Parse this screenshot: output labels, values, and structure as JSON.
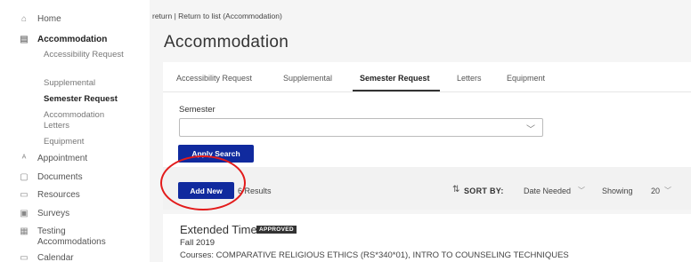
{
  "sidebar": {
    "items": [
      {
        "icon": "home-icon",
        "glyph": "⌂",
        "label": "Home"
      },
      {
        "icon": "chat-icon",
        "glyph": "▤",
        "label": "Accommodation"
      },
      {
        "icon": "appointment-icon",
        "glyph": "ᴬ",
        "label": "Appointment"
      },
      {
        "icon": "documents-icon",
        "glyph": "▢",
        "label": "Documents"
      },
      {
        "icon": "resources-icon",
        "glyph": "▭",
        "label": "Resources"
      },
      {
        "icon": "surveys-icon",
        "glyph": "▣",
        "label": "Surveys"
      },
      {
        "icon": "testing-icon",
        "glyph": "▦",
        "label": "Testing Accommodations"
      },
      {
        "icon": "calendar-icon",
        "glyph": "▭",
        "label": "Calendar"
      }
    ],
    "subitems": [
      {
        "label": "Accessibility Request"
      },
      {
        "label": "Supplemental"
      },
      {
        "label": "Semester Request"
      },
      {
        "label": "Accommodation Letters"
      },
      {
        "label": "Equipment"
      }
    ]
  },
  "main": {
    "breadcrumb": "return | Return to list (Accommodation)",
    "title": "Accommodation",
    "tabs": [
      {
        "label": "Accessibility Request"
      },
      {
        "label": "Supplemental"
      },
      {
        "label": "Semester Request"
      },
      {
        "label": "Letters"
      },
      {
        "label": "Equipment"
      }
    ],
    "semester_label": "Semester",
    "semester_value": "",
    "apply_label": "Apply Search",
    "add_new_label": "Add New",
    "results_count": "6 Results",
    "sort_by_label": "SORT BY:",
    "sort_value": "Date Needed",
    "showing_label": "Showing",
    "showing_value": "20",
    "item": {
      "title": "Extended Time",
      "badge": "APPROVED",
      "term": "Fall 2019",
      "courses": "Courses: COMPARATIVE RELIGIOUS ETHICS (RS*340*01), INTRO TO COUNSELING TECHNIQUES"
    }
  },
  "colors": {
    "primary_button": "#102a9e",
    "annotation_circle": "#e31b1b",
    "badge_bg": "#333333"
  }
}
